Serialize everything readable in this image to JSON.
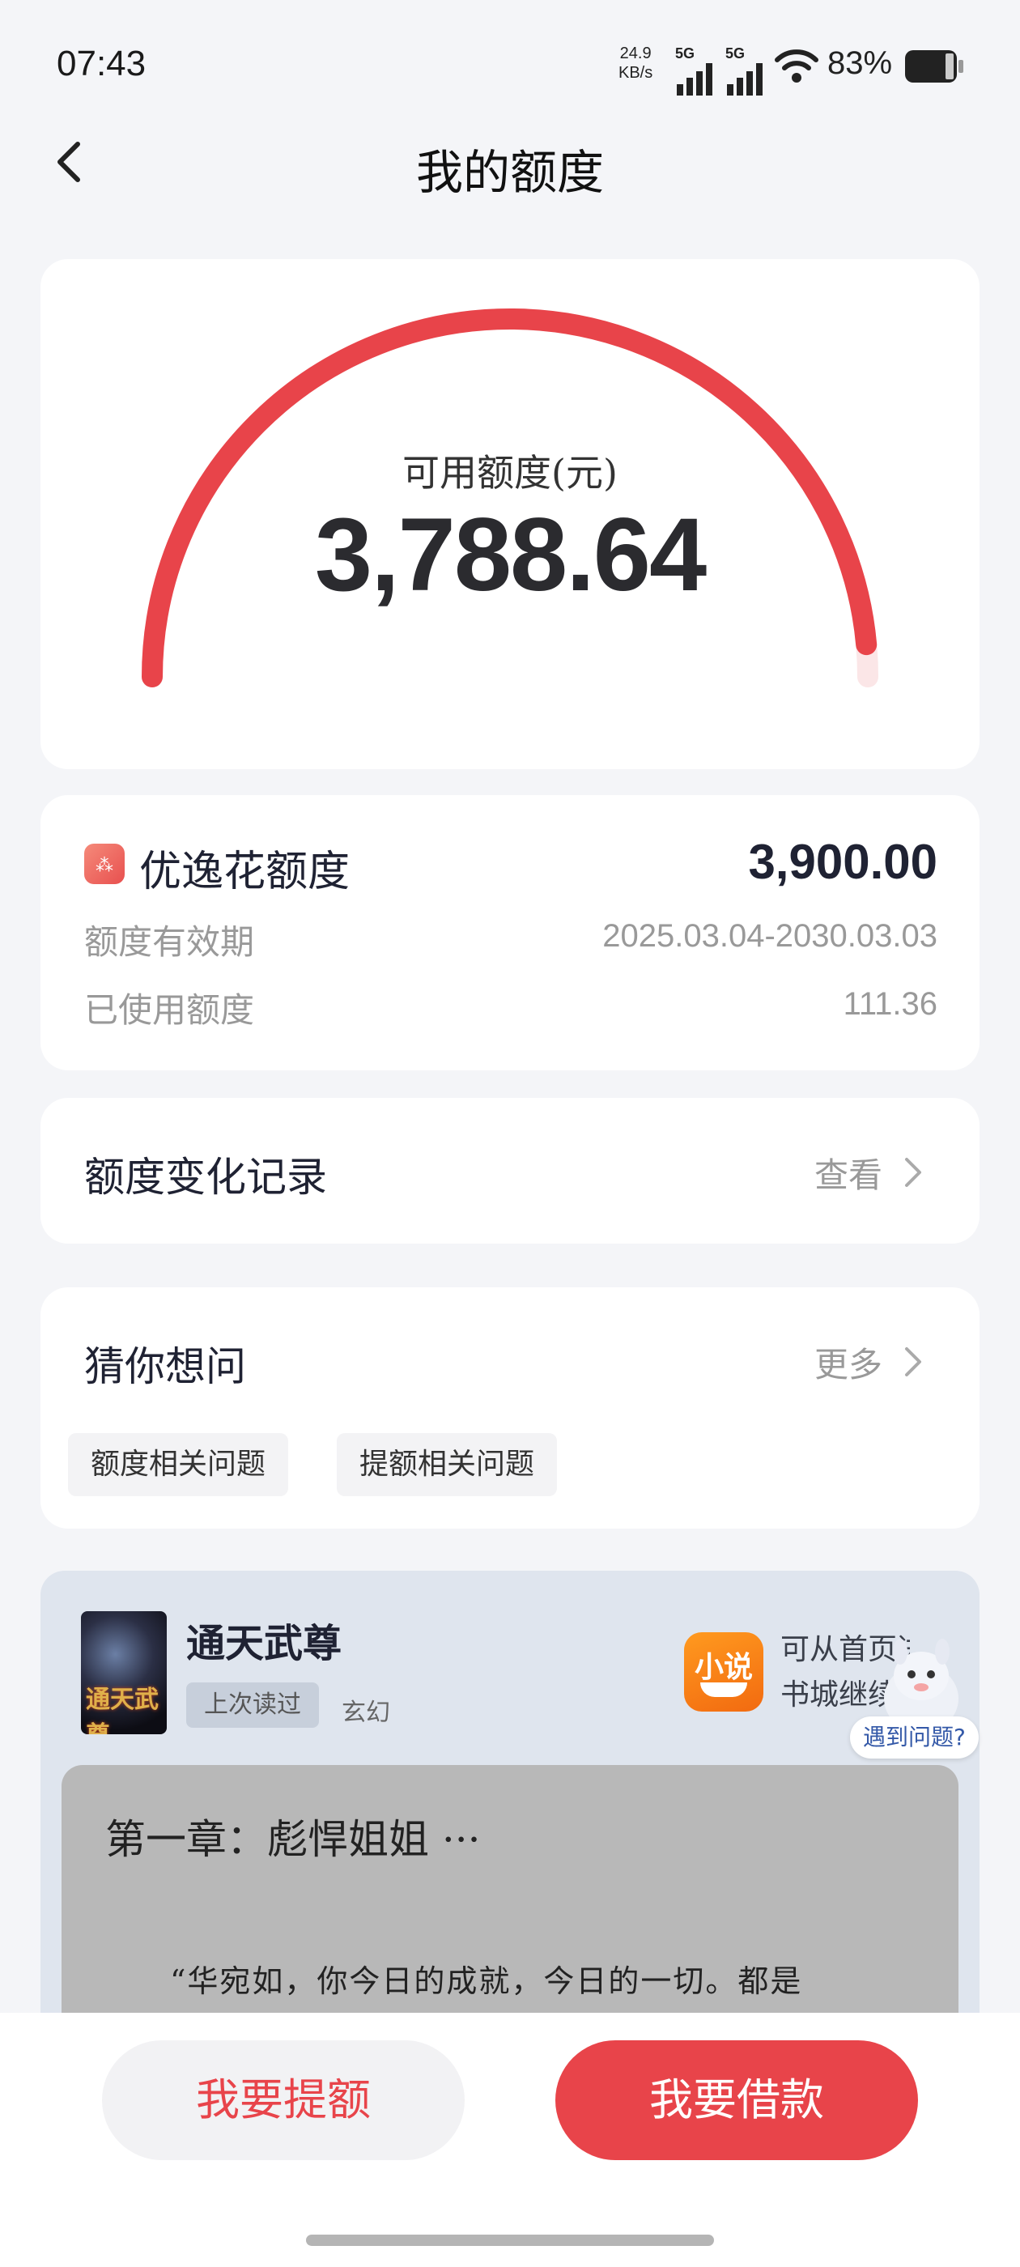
{
  "status_bar": {
    "time": "07:43",
    "net_speed_value": "24.9",
    "net_speed_unit": "KB/s",
    "signal_label": "5G",
    "battery": "83%"
  },
  "header": {
    "title": "我的额度"
  },
  "gauge": {
    "label": "可用额度(元)",
    "value": "3,788.64",
    "fraction_available": 0.9714,
    "color": "#e8444a"
  },
  "limit_card": {
    "name": "优逸花额度",
    "total": "3,900.00",
    "validity_label": "额度有效期",
    "validity_value": "2025.03.04-2030.03.03",
    "used_label": "已使用额度",
    "used_value": "111.36"
  },
  "record": {
    "label": "额度变化记录",
    "action": "查看"
  },
  "faq": {
    "title": "猜你想问",
    "more": "更多",
    "chips": [
      "额度相关问题",
      "提额相关问题"
    ]
  },
  "novel_ad": {
    "cover_text": "通天武尊",
    "book_title": "通天武尊",
    "last_read": "上次读过",
    "genre": "玄幻",
    "app_icon_label": "小说",
    "hint_line1": "可从首页进入",
    "hint_line2": "书城继续读",
    "help": "遇到问题?",
    "chapter_title": "第一章：彪悍姐姐 ···",
    "chapter_text": "“华宛如，你今日的成就，今日的一切。都是"
  },
  "actions": {
    "raise_label": "我要提额",
    "borrow_label": "我要借款"
  }
}
